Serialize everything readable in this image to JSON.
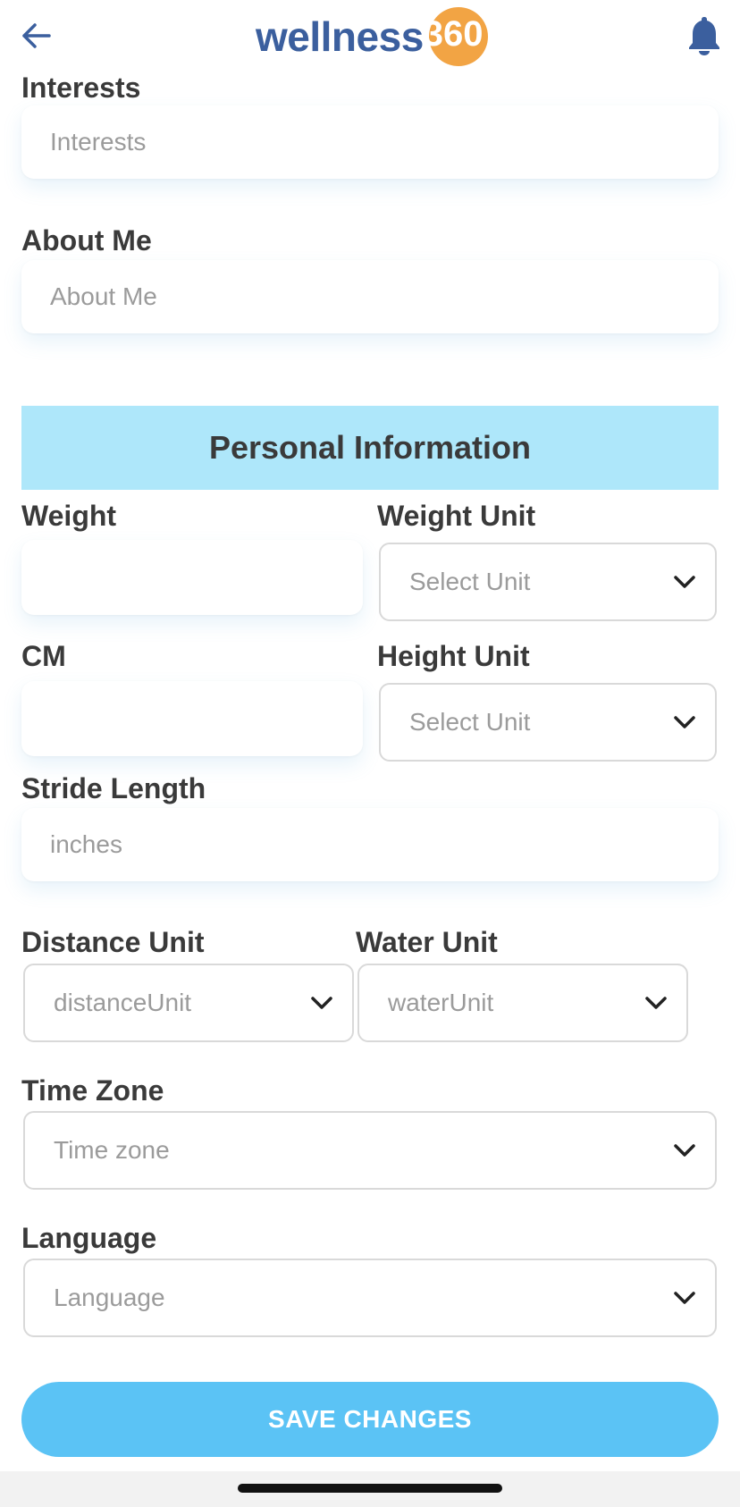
{
  "header": {
    "logo_word": "wellness",
    "logo_number": "360",
    "brand_blue": "#3b5f9e",
    "brand_orange": "#f2a444",
    "back_icon": "arrow-left-icon",
    "notification_icon": "bell-icon"
  },
  "profile": {
    "interests": {
      "label": "Interests",
      "placeholder": "Interests"
    },
    "about_me": {
      "label": "About Me",
      "placeholder": "About Me"
    }
  },
  "personal_info": {
    "title": "Personal Information",
    "weight": {
      "label": "Weight",
      "value": ""
    },
    "weight_unit": {
      "label": "Weight Unit",
      "placeholder": "Select Unit"
    },
    "height": {
      "label": "CM",
      "value": ""
    },
    "height_unit": {
      "label": "Height Unit",
      "placeholder": "Select Unit"
    },
    "stride_length": {
      "label": "Stride Length",
      "placeholder": "inches"
    },
    "distance_unit": {
      "label": "Distance Unit",
      "placeholder": "distanceUnit"
    },
    "water_unit": {
      "label": "Water Unit",
      "placeholder": "waterUnit"
    },
    "time_zone": {
      "label": "Time Zone",
      "placeholder": "Time zone"
    },
    "language": {
      "label": "Language",
      "placeholder": "Language"
    }
  },
  "actions": {
    "save_label": "SAVE CHANGES",
    "save_color": "#5bc3f5"
  },
  "colors": {
    "section_bar": "#aee7fa",
    "label_text": "#3a3a3a",
    "placeholder_text": "#9b9b9b"
  }
}
